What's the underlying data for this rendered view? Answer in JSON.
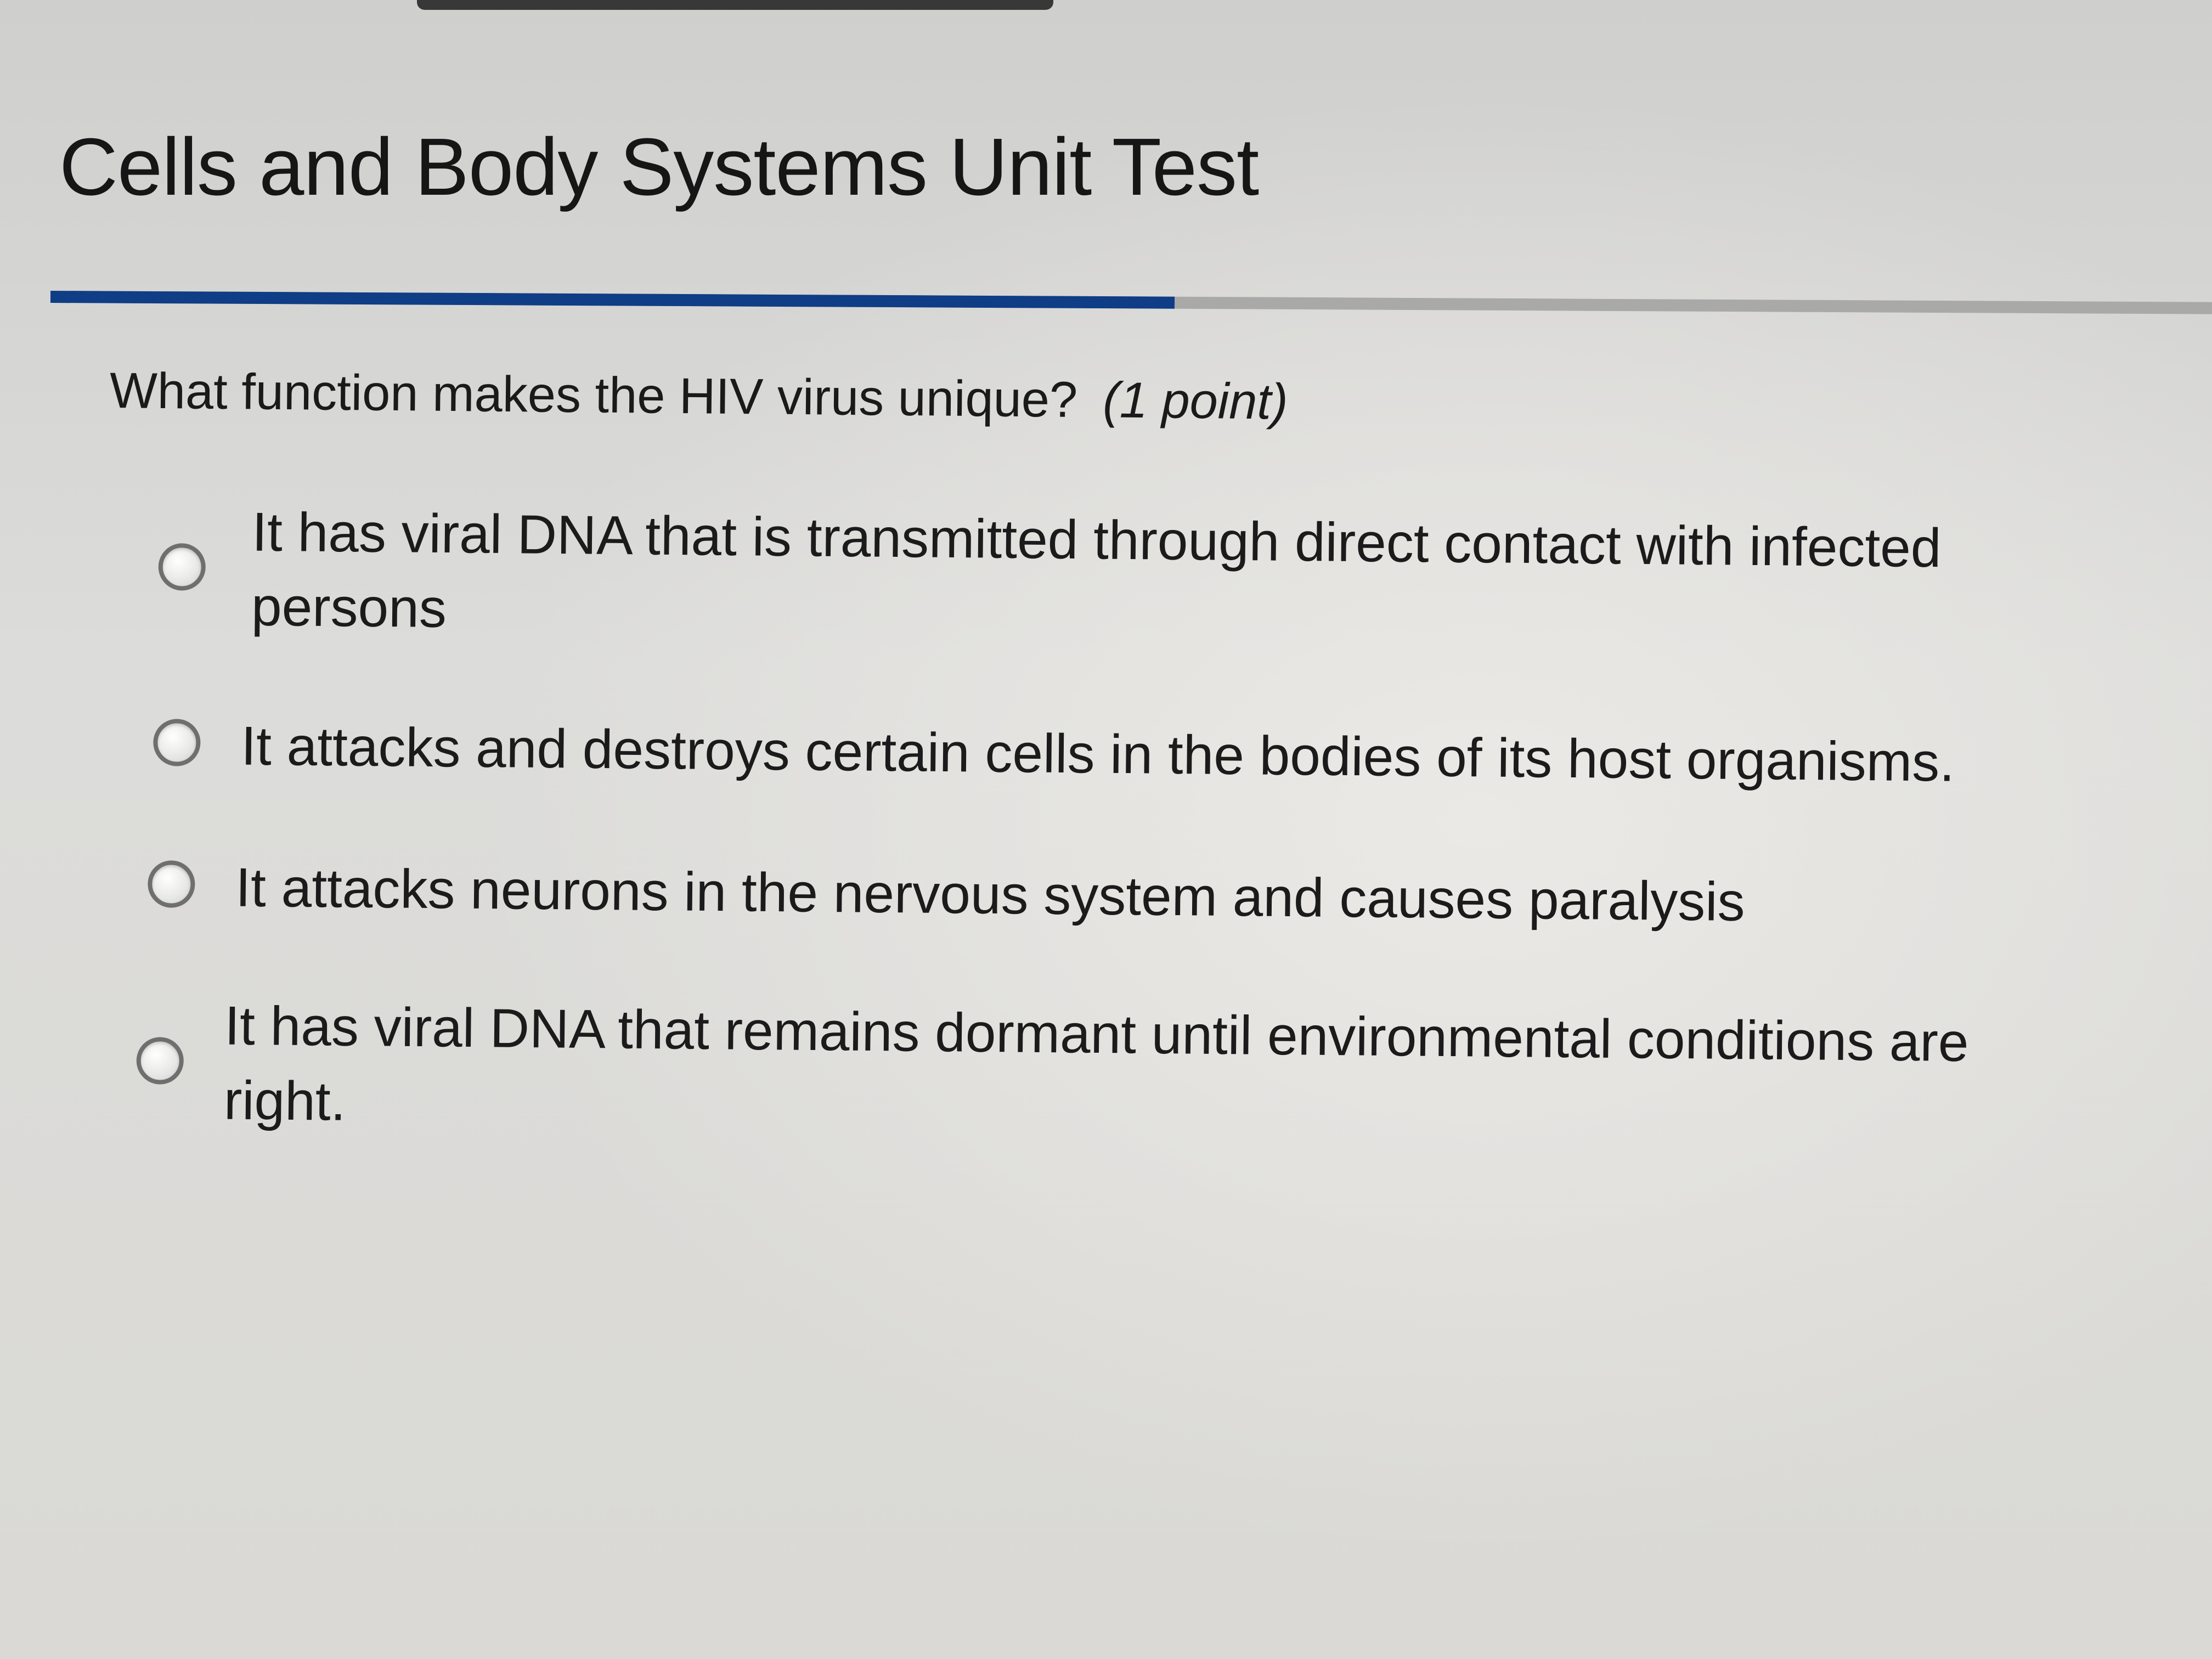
{
  "header": {
    "title": "Cells and Body Systems Unit Test"
  },
  "progress": {
    "fraction_complete": 0.52,
    "fill_color": "#0f3d86",
    "track_color": "#a9a9a7"
  },
  "question": {
    "prompt": "What function makes the HIV virus unique?",
    "points": "(1 point)"
  },
  "options": [
    {
      "line1": "It has viral DNA that is transmitted through direct contact with infected",
      "line2": "persons",
      "selected": false
    },
    {
      "line1": "It attacks and destroys certain cells in the bodies of its host organisms.",
      "selected": false
    },
    {
      "line1": "It attacks neurons in the nervous system and causes paralysis",
      "selected": false
    },
    {
      "line1": "It has viral DNA that remains dormant until environmental conditions are",
      "line2": "right.",
      "selected": false
    }
  ]
}
